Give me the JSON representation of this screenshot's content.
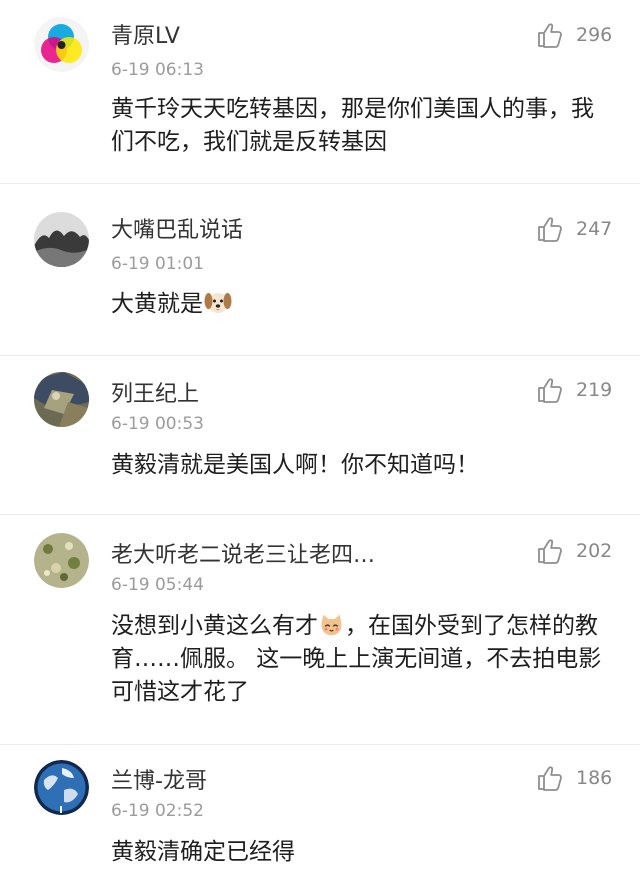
{
  "comments": [
    {
      "username": "青原LV",
      "time": "6-19 06:13",
      "likes": "296",
      "text": "黄千玲天天吃转基因，那是你们美国人的事，我们不吃，我们就是反转基因"
    },
    {
      "username": "大嘴巴乱说话",
      "time": "6-19 01:01",
      "likes": "247",
      "text": "大黄就是"
    },
    {
      "username": "列王纪上",
      "time": "6-19 00:53",
      "likes": "219",
      "text": "黄毅清就是美国人啊！你不知道吗！"
    },
    {
      "username": "老大听老二说老三让老四…",
      "time": "6-19 05:44",
      "likes": "202",
      "text_a": "没想到小黄这么有才",
      "text_b": "，在国外受到了怎样的教育……佩服。 这一晚上上演无间道，不去拍电影可惜这才花了"
    },
    {
      "username": "兰博-龙哥",
      "time": "6-19 02:52",
      "likes": "186",
      "text": "黄毅清确定已经得"
    }
  ],
  "icons": {
    "like": "thumbs-up-icon",
    "emoji_dog": "dog-face-emoji",
    "emoji_cat": "cat-face-emoji"
  },
  "colors": {
    "username": "#333333",
    "timestamp": "#9b9b9b",
    "like_count": "#888888",
    "divider": "#ececec"
  }
}
